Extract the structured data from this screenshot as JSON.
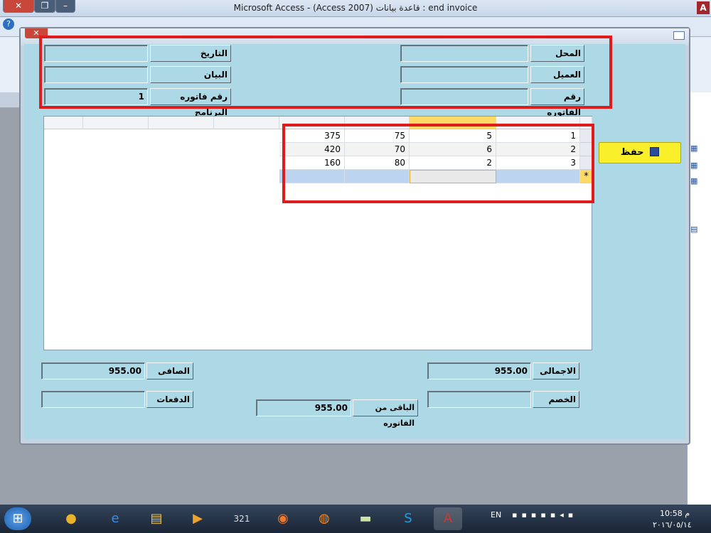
{
  "app": {
    "window_title": "Microsoft Access - (Access 2007) قاعدة بيانات : end invoice"
  },
  "header": {
    "place_label": "المحل",
    "place_value": "",
    "customer_label": "العميل",
    "customer_value": "",
    "invoice_no_label": "رقم الفاتوره",
    "invoice_no_value": "",
    "date_label": "التاريخ",
    "date_value": "",
    "description_label": "البيان",
    "description_value": "",
    "program_invoice_no_label": "رقم فاتوره البرنامج",
    "program_invoice_no_value": "1"
  },
  "grid": {
    "rows": [
      {
        "c1": "1",
        "c2": "5",
        "c3": "75",
        "c4": "375"
      },
      {
        "c1": "2",
        "c2": "6",
        "c3": "70",
        "c4": "420"
      },
      {
        "c1": "3",
        "c2": "2",
        "c3": "80",
        "c4": "160"
      }
    ],
    "new_row_marker": "*"
  },
  "actions": {
    "save_label": "حفظ"
  },
  "totals": {
    "total_label": "الاجمالى",
    "total_value": "955.00",
    "net_label": "الصافى",
    "net_value": "955.00",
    "discount_label": "الخصم",
    "discount_value": "",
    "payments_label": "الدفعات",
    "payments_value": "",
    "remaining_label": "الباقى من الفاتوره",
    "remaining_value": "955.00"
  },
  "taskbar": {
    "lang": "EN",
    "time": "10:58 م",
    "date": "٢٠١٦/٠٥/١٤"
  },
  "colors": {
    "form_bg": "#add8e6",
    "highlight": "#e01b1b",
    "save_bg": "#f9ef2a"
  }
}
